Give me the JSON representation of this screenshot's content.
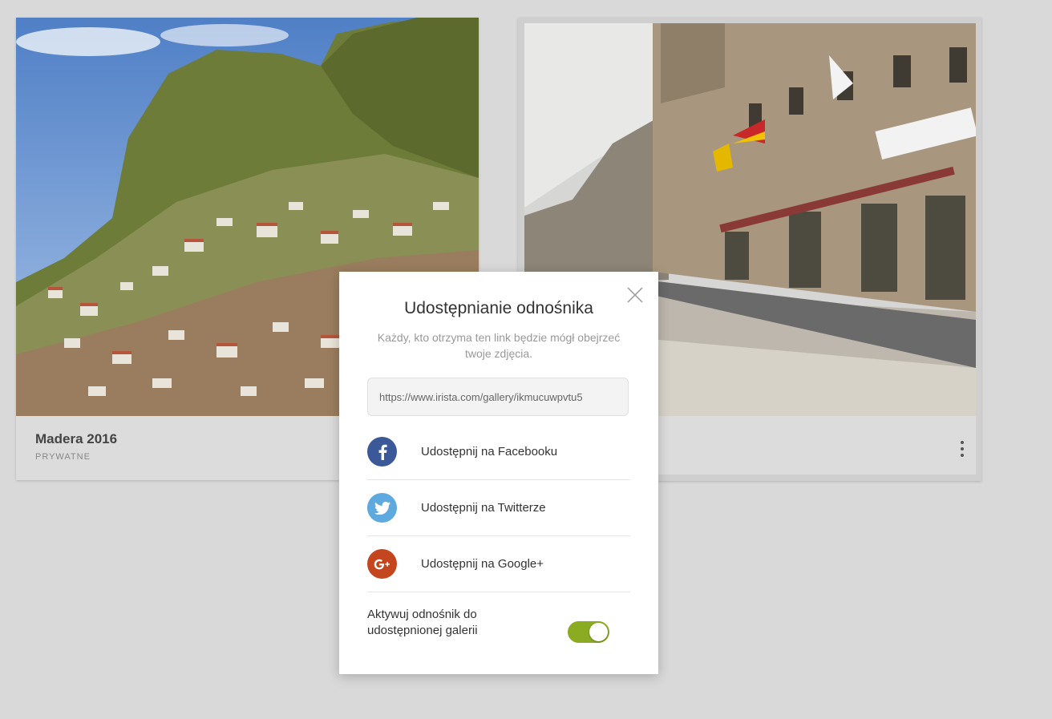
{
  "galleries": [
    {
      "title": "Madera 2016",
      "privacy": "PRYWATNE"
    },
    {
      "title": "",
      "privacy": ""
    }
  ],
  "icons": {
    "more": "kebab-vertical-icon",
    "close": "close-x-icon"
  },
  "share_dialog": {
    "title": "Udostępnianie odnośnika",
    "description": "Każdy, kto otrzyma ten link będzie mógł obejrzeć twoje zdjęcia.",
    "link_value": "https://www.irista.com/gallery/ikmucuwpvtu5",
    "options": [
      {
        "label": "Udostępnij na Facebooku",
        "icon": "facebook-icon",
        "color": "#3b5998"
      },
      {
        "label": "Udostępnij na Twitterze",
        "icon": "twitter-icon",
        "color": "#5ea9dd"
      },
      {
        "label": "Udostępnij na Google+",
        "icon": "google-plus-icon",
        "color": "#c4461f"
      }
    ],
    "toggle": {
      "label": "Aktywuj odnośnik do udostępnionej galerii",
      "on": true,
      "color": "#8aab22"
    }
  }
}
